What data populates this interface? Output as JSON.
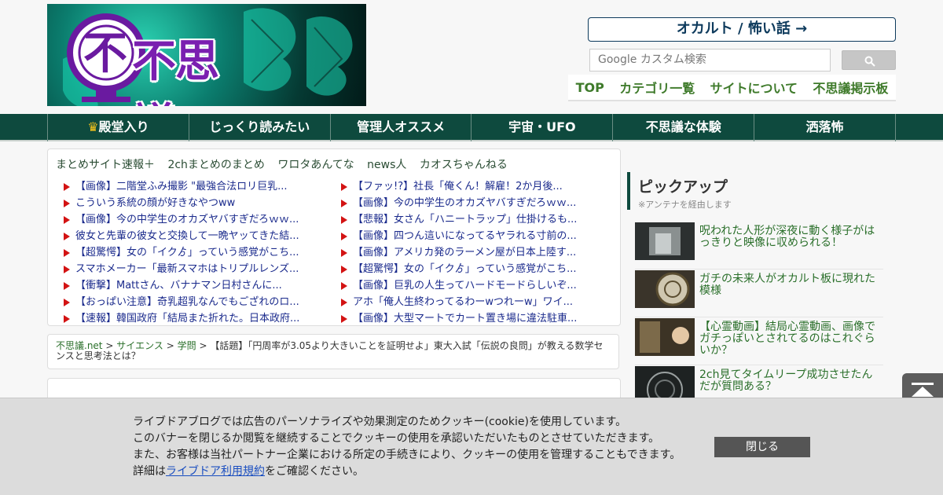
{
  "header": {
    "logo_text": "不思議.NET",
    "occult_button": "オカルト / 怖い話 →",
    "search_placeholder": "Google カスタム検索",
    "top_nav": [
      "TOP",
      "カテゴリ一覧",
      "サイトについて",
      "不思議掲示板"
    ]
  },
  "categories": [
    {
      "label": "殿堂入り",
      "icon": "crown-icon"
    },
    {
      "label": "じっくり読みたい"
    },
    {
      "label": "管理人オススメ"
    },
    {
      "label": "宇宙・UFO"
    },
    {
      "label": "不思議な体験"
    },
    {
      "label": "洒落怖"
    }
  ],
  "antenna": {
    "tabs": [
      "まとめサイト速報＋",
      "2chまとめのまとめ",
      "ワロタあんてな",
      "news人",
      "カオスちゃんねる"
    ],
    "left_links": [
      "【画像】二階堂ふみ撮影 \"最強合法ロリ巨乳...",
      "こういう系統の顔が好きなやつww",
      "【画像】今の中学生のオカズヤバすぎだろｗｗ...",
      "彼女と先輩の彼女と交換して一晩ヤッてきた結...",
      "【超驚愕】女の「イクゟ」っていう感覚がこち...",
      "スマホメーカー「最新スマホはトリプルレンズ...",
      "【衝撃】Mattさん、バナナマン日村さんに...",
      "【おっぱい注意】奇乳超乳なんでもござれのロ...",
      "【速報】韓国政府「結局また折れた。日本政府..."
    ],
    "right_links": [
      "【ファッ!?】社長「俺くん！解雇！2か月後...",
      "【画像】今の中学生のオカズヤバすぎだろｗｗ...",
      "【悲報】女さん「ハニートラップ」仕掛けるも...",
      "【画像】四つん這いになってるヤラれる寸前の...",
      "【画像】アメリカ発のラーメン屋が日本上陸す...",
      "【超驚愕】女の「イクゟ」っていう感覚がこち...",
      "【画像】巨乳の人生ってハードモードらしいぞ...",
      "アホ「俺人生終わってるわーwつれーw」ワイ...",
      "【画像】大型マートでカート置き場に違法駐車..."
    ]
  },
  "breadcrumb": {
    "home": "不思議.net",
    "sep": ">",
    "cat1": "サイエンス",
    "cat2": "学問",
    "title": "【話題】「円周率が3.05より大きいことを証明せよ」東大入試「伝説の良問」が教える数学センスと思考法とは？"
  },
  "sidebar": {
    "pickup_title": "ピックアップ",
    "pickup_sub": "※アンテナを経由します",
    "items": [
      "呪われた人形が深夜に動く様子がはっきりと映像に収められる！",
      "ガチの未来人がオカルト板に現れた模様",
      "【心霊動画】結局心霊動画、画像でガチっぽいとされてるのはこれぐらいか？",
      "2ch見てタイムリープ成功させたんだが質問ある？"
    ]
  },
  "cookie": {
    "line1": "ライブドアブログでは広告のパーソナライズや効果測定のためクッキー(cookie)を使用しています。",
    "line2": "このバナーを閉じるか閲覧を継続することでクッキーの使用を承認いただいたものとさせていただきます。",
    "line3": "また、お客様は当社パートナー企業における所定の手続きにより、クッキーの使用を管理することもできます。",
    "line4_pre": "詳細は",
    "line4_link": "ライブドア利用規約",
    "line4_post": "をご確認ください。",
    "close": "閉じる"
  },
  "colors": {
    "nav_bg": "#0e4a3e",
    "link_green": "#2a6f2a",
    "arrow_red": "#d31313",
    "logo_purple": "#7a1fb0"
  }
}
